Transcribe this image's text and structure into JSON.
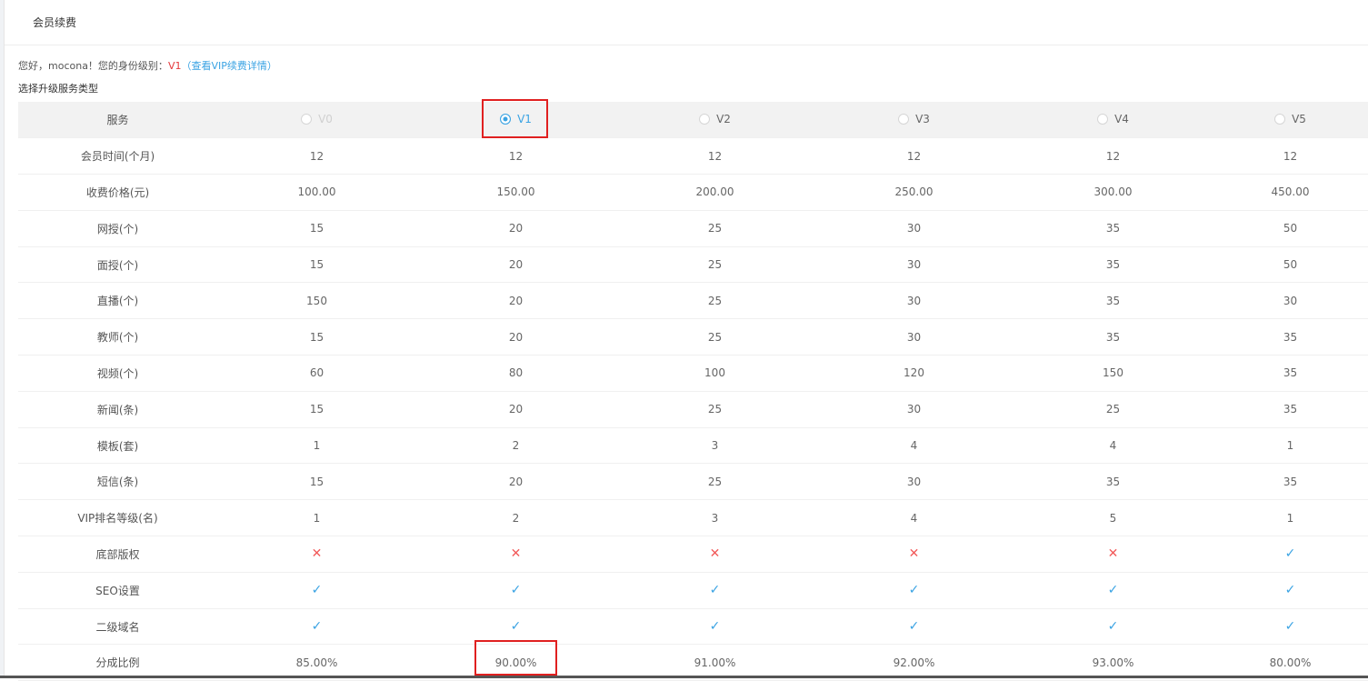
{
  "header": {
    "title": "会员续费"
  },
  "greeting": {
    "prefix": "您好，mocona！您的身份级别：",
    "level": "V1",
    "link": "（查看VIP续费详情）"
  },
  "subtitle": "选择升级服务类型",
  "table": {
    "service_label": "服务",
    "levels": [
      "V0",
      "V1",
      "V2",
      "V3",
      "V4",
      "V5"
    ],
    "selected_level": "V1",
    "rows": [
      {
        "label": "会员时间(个月)",
        "values": [
          "12",
          "12",
          "12",
          "12",
          "12",
          "12"
        ]
      },
      {
        "label": "收费价格(元)",
        "values": [
          "100.00",
          "150.00",
          "200.00",
          "250.00",
          "300.00",
          "450.00"
        ]
      },
      {
        "label": "网授(个)",
        "values": [
          "15",
          "20",
          "25",
          "30",
          "35",
          "50"
        ]
      },
      {
        "label": "面授(个)",
        "values": [
          "15",
          "20",
          "25",
          "30",
          "35",
          "50"
        ]
      },
      {
        "label": "直播(个)",
        "values": [
          "150",
          "20",
          "25",
          "30",
          "35",
          "30"
        ]
      },
      {
        "label": "教师(个)",
        "values": [
          "15",
          "20",
          "25",
          "30",
          "35",
          "35"
        ]
      },
      {
        "label": "视频(个)",
        "values": [
          "60",
          "80",
          "100",
          "120",
          "150",
          "35"
        ]
      },
      {
        "label": "新闻(条)",
        "values": [
          "15",
          "20",
          "25",
          "30",
          "25",
          "35"
        ]
      },
      {
        "label": "模板(套)",
        "values": [
          "1",
          "2",
          "3",
          "4",
          "4",
          "1"
        ]
      },
      {
        "label": "短信(条)",
        "values": [
          "15",
          "20",
          "25",
          "30",
          "35",
          "35"
        ]
      },
      {
        "label": "VIP排名等级(名)",
        "values": [
          "1",
          "2",
          "3",
          "4",
          "5",
          "1"
        ]
      },
      {
        "label": "底部版权",
        "icons": [
          "cross-icon",
          "cross-icon",
          "cross-icon",
          "cross-icon",
          "cross-icon",
          "check-icon"
        ]
      },
      {
        "label": "SEO设置",
        "icons": [
          "check-icon",
          "check-icon",
          "check-icon",
          "check-icon",
          "check-icon",
          "check-icon"
        ]
      },
      {
        "label": "二级域名",
        "icons": [
          "check-icon",
          "check-icon",
          "check-icon",
          "check-icon",
          "check-icon",
          "check-icon"
        ]
      },
      {
        "label": "分成比例",
        "values": [
          "85.00%",
          "90.00%",
          "91.00%",
          "92.00%",
          "93.00%",
          "80.00%"
        ]
      }
    ]
  },
  "colors": {
    "accent": "#3aa3e3",
    "level_text": "#e4393c",
    "cross": "#f25a5a",
    "highlight_box": "#e02020",
    "header_row_bg": "#f2f2f2"
  }
}
